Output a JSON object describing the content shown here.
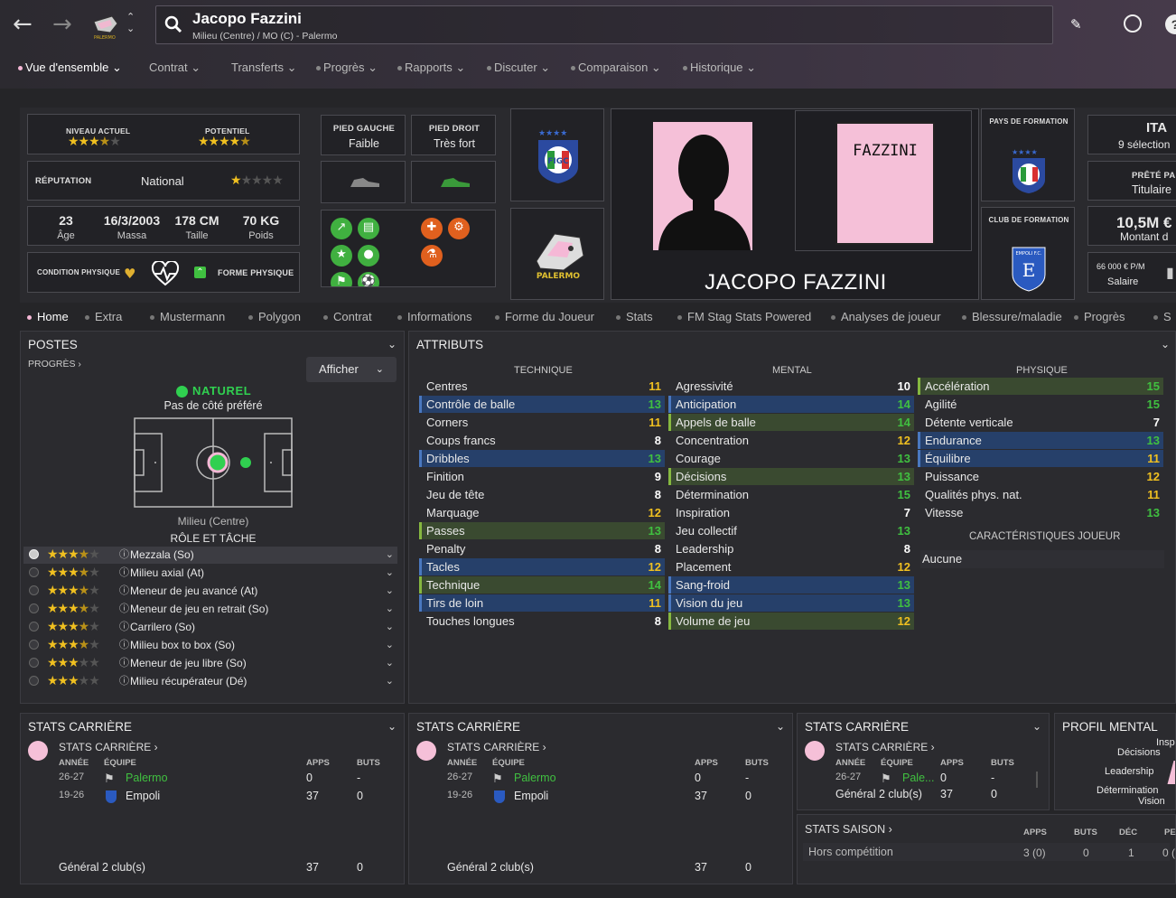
{
  "header": {
    "title": "Jacopo Fazzini",
    "subtitle": "Milieu (Centre) / MO (C) - Palermo"
  },
  "menu": [
    {
      "label": "Vue d'ensemble ⌄",
      "active": true
    },
    {
      "label": "Contrat ⌄"
    },
    {
      "label": "Transferts ⌄"
    },
    {
      "label": "Progrès ⌄"
    },
    {
      "label": "Rapports ⌄"
    },
    {
      "label": "Discuter ⌄"
    },
    {
      "label": "Comparaison ⌄"
    },
    {
      "label": "Historique ⌄"
    }
  ],
  "ability": {
    "current_label": "NIVEAU ACTUEL",
    "potential_label": "POTENTIEL",
    "current_stars": 3.5,
    "potential_stars": 4.5
  },
  "reputation": {
    "label": "RÉPUTATION",
    "value": "National",
    "stars": 1
  },
  "bio": {
    "age": "23",
    "age_label": "Âge",
    "dob": "16/3/2003",
    "dob_label": "Massa",
    "height": "178 CM",
    "height_label": "Taille",
    "weight": "70 KG",
    "weight_label": "Poids"
  },
  "condition": {
    "label": "CONDITION PHYSIQUE",
    "form": "FORME PHYSIQUE"
  },
  "feet": {
    "left_label": "PIED GAUCHE",
    "left_value": "Faible",
    "right_label": "PIED DROIT",
    "right_value": "Très fort"
  },
  "figc_text": "FIGC",
  "palermo_text": "PALERMO",
  "shirt_name": "FAZZINI",
  "player_name": "JACOPO FAZZINI",
  "origin": {
    "country_label": "PAYS DE FORMATION",
    "club_label": "CLUB DE FORMATION",
    "empoli_text": "EMPOLI F.C."
  },
  "right_cards": {
    "nation": "ITA",
    "caps": "9 sélection",
    "loan_label": "PRÊTÉ PA",
    "loan_value": "Titulaire",
    "value": "10,5M €",
    "value_label": "Montant d",
    "wage": "66 000 € P/M",
    "wage_label": "Salaire"
  },
  "tabs": [
    {
      "label": "Home",
      "active": true
    },
    {
      "label": "Extra"
    },
    {
      "label": "Mustermann"
    },
    {
      "label": "Polygon"
    },
    {
      "label": "Contrat"
    },
    {
      "label": "Informations"
    },
    {
      "label": "Forme du Joueur"
    },
    {
      "label": "Stats"
    },
    {
      "label": "FM Stag Stats Powered"
    },
    {
      "label": "Analyses de joueur"
    },
    {
      "label": "Blessure/maladie"
    },
    {
      "label": "Progrès"
    },
    {
      "label": "S"
    }
  ],
  "positions": {
    "title": "POSTES",
    "progress": "PROGRÈS",
    "show": "Afficher",
    "natural": "NATUREL",
    "side": "Pas de côté préféré",
    "position": "Milieu (Centre)",
    "role_title": "RÔLE ET TÂCHE"
  },
  "roles": [
    {
      "name": "Mezzala (So)",
      "stars": 3.5,
      "selected": true
    },
    {
      "name": "Milieu axial (At)",
      "stars": 3.5
    },
    {
      "name": "Meneur de jeu avancé (At)",
      "stars": 3.5
    },
    {
      "name": "Meneur de jeu en retrait (So)",
      "stars": 3.5
    },
    {
      "name": "Carrilero (So)",
      "stars": 3.5
    },
    {
      "name": "Milieu box to box (So)",
      "stars": 3.5
    },
    {
      "name": "Meneur de jeu libre (So)",
      "stars": 3
    },
    {
      "name": "Milieu récupérateur (Dé)",
      "stars": 3
    }
  ],
  "attributes": {
    "title": "ATTRIBUTS",
    "technique_label": "TECHNIQUE",
    "mental_label": "MENTAL",
    "physique_label": "PHYSIQUE",
    "traits_label": "CARACTÉRISTIQUES JOUEUR",
    "traits_value": "Aucune",
    "technique": [
      {
        "n": "Centres",
        "v": "11",
        "c": "#f0c020"
      },
      {
        "n": "Contrôle de balle",
        "v": "13",
        "c": "#40c040",
        "h": "blue"
      },
      {
        "n": "Corners",
        "v": "11",
        "c": "#f0c020"
      },
      {
        "n": "Coups francs",
        "v": "8",
        "c": "#ffffff"
      },
      {
        "n": "Dribbles",
        "v": "13",
        "c": "#40c040",
        "h": "blue"
      },
      {
        "n": "Finition",
        "v": "9",
        "c": "#ffffff"
      },
      {
        "n": "Jeu de tête",
        "v": "8",
        "c": "#ffffff"
      },
      {
        "n": "Marquage",
        "v": "12",
        "c": "#f0c020"
      },
      {
        "n": "Passes",
        "v": "13",
        "c": "#40c040",
        "h": "green"
      },
      {
        "n": "Penalty",
        "v": "8",
        "c": "#ffffff"
      },
      {
        "n": "Tacles",
        "v": "12",
        "c": "#f0c020",
        "h": "blue"
      },
      {
        "n": "Technique",
        "v": "14",
        "c": "#40c040",
        "h": "green"
      },
      {
        "n": "Tirs de loin",
        "v": "11",
        "c": "#f0c020",
        "h": "blue"
      },
      {
        "n": "Touches longues",
        "v": "8",
        "c": "#ffffff"
      }
    ],
    "mental": [
      {
        "n": "Agressivité",
        "v": "10",
        "c": "#ffffff"
      },
      {
        "n": "Anticipation",
        "v": "14",
        "c": "#40c040",
        "h": "blue"
      },
      {
        "n": "Appels de balle",
        "v": "14",
        "c": "#40c040",
        "h": "green"
      },
      {
        "n": "Concentration",
        "v": "12",
        "c": "#f0c020"
      },
      {
        "n": "Courage",
        "v": "13",
        "c": "#40c040"
      },
      {
        "n": "Décisions",
        "v": "13",
        "c": "#40c040",
        "h": "green"
      },
      {
        "n": "Détermination",
        "v": "15",
        "c": "#40c040"
      },
      {
        "n": "Inspiration",
        "v": "7",
        "c": "#ffffff"
      },
      {
        "n": "Jeu collectif",
        "v": "13",
        "c": "#40c040"
      },
      {
        "n": "Leadership",
        "v": "8",
        "c": "#ffffff"
      },
      {
        "n": "Placement",
        "v": "12",
        "c": "#f0c020"
      },
      {
        "n": "Sang-froid",
        "v": "13",
        "c": "#40c040",
        "h": "blue"
      },
      {
        "n": "Vision du jeu",
        "v": "13",
        "c": "#40c040",
        "h": "blue"
      },
      {
        "n": "Volume de jeu",
        "v": "12",
        "c": "#f0c020",
        "h": "green"
      }
    ],
    "physique": [
      {
        "n": "Accélération",
        "v": "15",
        "c": "#40c040",
        "h": "green"
      },
      {
        "n": "Agilité",
        "v": "15",
        "c": "#40c040"
      },
      {
        "n": "Détente verticale",
        "v": "7",
        "c": "#ffffff"
      },
      {
        "n": "Endurance",
        "v": "13",
        "c": "#40c040",
        "h": "blue"
      },
      {
        "n": "Équilibre",
        "v": "11",
        "c": "#f0c020",
        "h": "blue"
      },
      {
        "n": "Puissance",
        "v": "12",
        "c": "#f0c020"
      },
      {
        "n": "Qualités phys. nat.",
        "v": "11",
        "c": "#f0c020"
      },
      {
        "n": "Vitesse",
        "v": "13",
        "c": "#40c040"
      }
    ]
  },
  "career": {
    "title": "STATS CARRIÈRE",
    "sub": "STATS CARRIÈRE",
    "col_year": "ANNÉE",
    "col_team": "ÉQUIPE",
    "col_apps": "APPS",
    "col_goals": "BUTS",
    "rows": [
      {
        "year": "26-27",
        "team": "Palermo",
        "apps": "0",
        "goals": "-"
      },
      {
        "year": "19-26",
        "team": "Empoli",
        "apps": "37",
        "goals": "0"
      }
    ],
    "total_label": "Général 2 club(s)",
    "total_apps": "37",
    "total_goals": "0",
    "team_short": "Pale..."
  },
  "season": {
    "title": "STATS SAISON",
    "col_apps": "APPS",
    "col_goals": "BUTS",
    "col_dec": "DÉC",
    "col_pe": "PE",
    "row_label": "Hors compétition",
    "apps": "3 (0)",
    "goals": "0",
    "dec": "1",
    "pe": "0 ("
  },
  "mental_profile": {
    "title": "PROFIL MENTAL",
    "labels": [
      "Insp",
      "Décisions",
      "Leadership",
      "Détermination",
      "Vision"
    ]
  },
  "colors": {
    "accent_pink": "#f5b8d6",
    "high": "#40c040",
    "mid": "#f0c020",
    "palermo_green": "#40c040"
  }
}
